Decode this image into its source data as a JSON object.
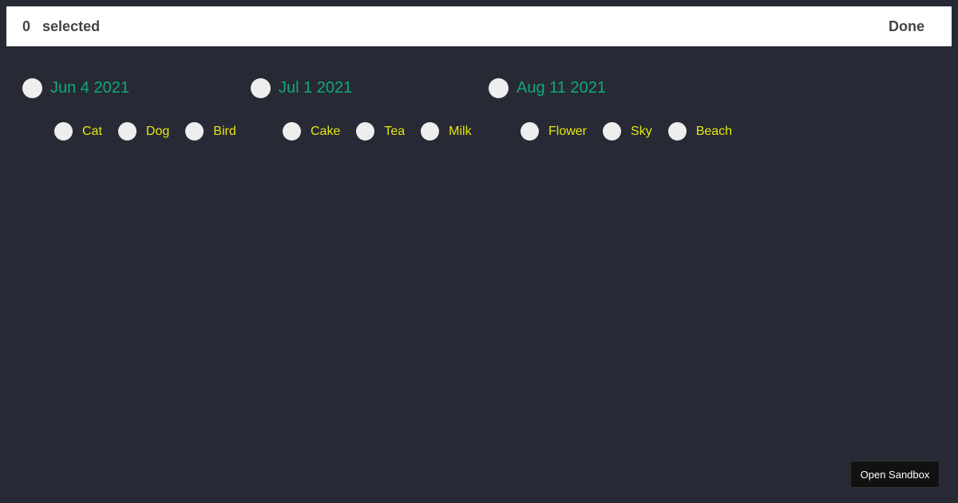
{
  "header": {
    "count": "0",
    "selected_label": "selected",
    "done_label": "Done"
  },
  "groups": [
    {
      "date": "Jun 4 2021",
      "items": [
        {
          "label": "Cat"
        },
        {
          "label": "Dog"
        },
        {
          "label": "Bird"
        }
      ]
    },
    {
      "date": "Jul 1 2021",
      "items": [
        {
          "label": "Cake"
        },
        {
          "label": "Tea"
        },
        {
          "label": "Milk"
        }
      ]
    },
    {
      "date": "Aug 11 2021",
      "items": [
        {
          "label": "Flower"
        },
        {
          "label": "Sky"
        },
        {
          "label": "Beach"
        }
      ]
    }
  ],
  "sandbox_button": "Open Sandbox",
  "colors": {
    "background": "#272a35",
    "date_text": "#12a877",
    "item_text": "#e6e60f",
    "radio": "#eeeeee"
  }
}
